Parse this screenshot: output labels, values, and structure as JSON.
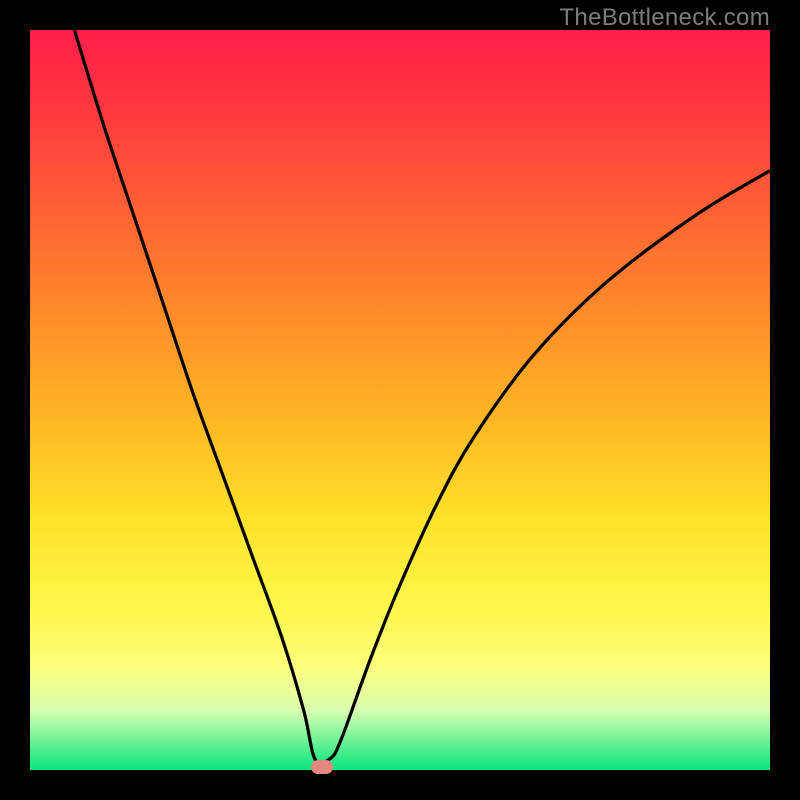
{
  "watermark": "TheBottleneck.com",
  "chart_data": {
    "type": "line",
    "title": "",
    "xlabel": "",
    "ylabel": "",
    "xlim": [
      0,
      100
    ],
    "ylim": [
      0,
      100
    ],
    "background_gradient": {
      "top": "#ff1f4a",
      "mid1": "#ffb524",
      "mid2": "#fff74a",
      "bottom": "#07e67d"
    },
    "series": [
      {
        "name": "bottleneck-curve",
        "color": "#000000",
        "x": [
          6,
          10,
          14,
          18,
          22,
          26,
          30,
          34,
          37,
          38.5,
          40.5,
          42,
          46,
          50,
          55,
          60,
          68,
          78,
          90,
          100
        ],
        "y": [
          100,
          87,
          75,
          63,
          51,
          40,
          29,
          18,
          8,
          1.5,
          1.5,
          4,
          15,
          25,
          36,
          45,
          56,
          66,
          75,
          81
        ]
      }
    ],
    "marker": {
      "name": "optimal-point",
      "color": "#e4887e",
      "x": 39.5,
      "y": 0.4
    }
  }
}
